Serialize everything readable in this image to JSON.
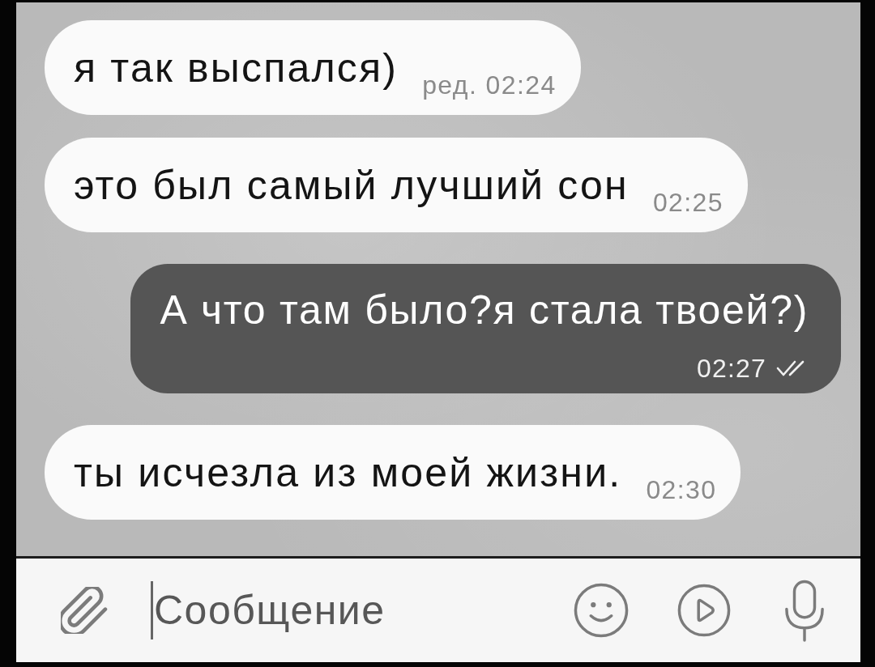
{
  "messages": [
    {
      "kind": "incoming",
      "text": "я так выспался)",
      "time": "ред. 02:24"
    },
    {
      "kind": "incoming",
      "text": "это был самый лучший сон",
      "time": "02:25"
    },
    {
      "kind": "outgoing",
      "text": "А что там было?я стала твоей?)",
      "time": "02:27",
      "read": true
    },
    {
      "kind": "incoming",
      "text": "ты исчезла из моей жизни.",
      "time": "02:30"
    }
  ],
  "composer": {
    "placeholder": "Сообщение",
    "focused": true
  }
}
